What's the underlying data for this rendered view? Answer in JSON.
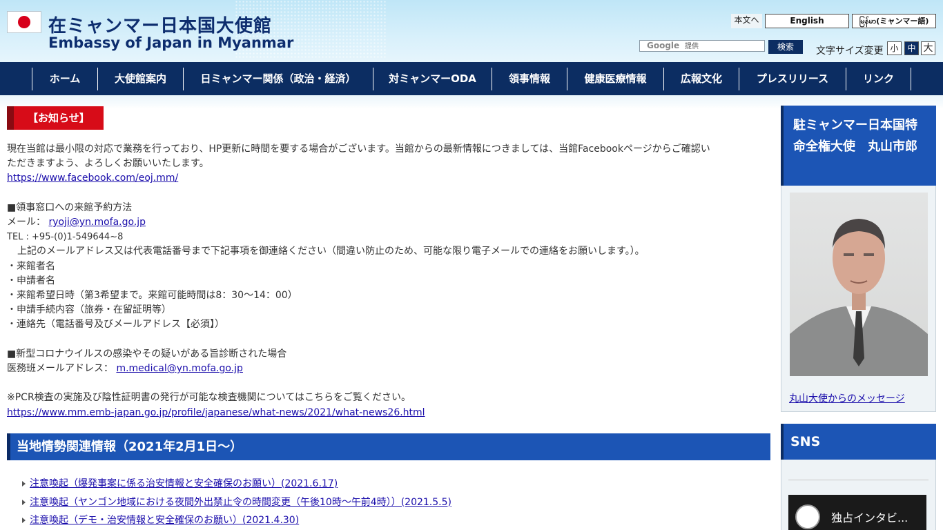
{
  "header": {
    "title_ja": "在ミャンマー日本国大使館",
    "title_en": "Embassy of Japan in Myanmar",
    "skip_label": "本文へ",
    "english_label": "English",
    "myanmar_label": "မြန်မာ(ミャンマー語)",
    "search_provider": "Google",
    "search_placeholder": "提供",
    "search_button": "検索",
    "fontsize_label": "文字サイズ変更",
    "fontsize_small": "小",
    "fontsize_medium": "中",
    "fontsize_large": "大"
  },
  "nav": {
    "items": [
      {
        "label": "ホーム"
      },
      {
        "label": "大使館案内"
      },
      {
        "label": "日ミャンマー関係（政治・経済）"
      },
      {
        "label": "対ミャンマーODA"
      },
      {
        "label": "領事情報"
      },
      {
        "label": "健康医療情報"
      },
      {
        "label": "広報文化"
      },
      {
        "label": "プレスリリース"
      },
      {
        "label": "リンク"
      }
    ]
  },
  "notice": {
    "title": "【お知らせ】",
    "para1_line1": "現在当館は最小限の対応で業務を行っており、HP更新に時間を要する場合がございます。当館からの最新情報につきましては、当館Facebookページからご確認い",
    "para1_line2": "ただきますよう、よろしくお願いいたします。",
    "facebook_link": "https://www.facebook.com/eoj.mm/",
    "reservation_heading": "■領事窓口への来館予約方法",
    "mail_label": "メール：",
    "mail_link": "ryoji@yn.mofa.go.jp",
    "tel": "TEL : +95-(0)1-549644~8",
    "instruction": "上記のメールアドレス又は代表電話番号まで下記事項を御連絡ください（間違い防止のため、可能な限り電子メールでの連絡をお願いします。）。",
    "items": [
      "・来館者名",
      "・申請者名",
      "・来館希望日時（第3希望まで。来館可能時間は8：30〜14：00）",
      "・申請手続内容（旅券・在留証明等）",
      "・連絡先（電話番号及びメールアドレス【必須】）"
    ],
    "covid_heading": "■新型コロナウイルスの感染やその疑いがある旨診断された場合",
    "medical_label": "医務班メールアドレス：",
    "medical_link": "m.medical@yn.mofa.go.jp",
    "pcr_note": "※PCR検査の実施及び陰性証明書の発行が可能な検査機関についてはこちらをご覧ください。",
    "pcr_link": "https://www.mm.emb-japan.go.jp/profile/japanese/what-news/2021/what-news26.html"
  },
  "situation": {
    "title": "当地情勢関連情報（2021年2月1日〜）",
    "links": [
      "注意喚起（爆発事案に係る治安情報と安全確保のお願い）(2021.6.17)",
      "注意喚起（ヤンゴン地域における夜間外出禁止令の時間変更（午後10時〜午前4時））(2021.5.5)",
      "注意喚起（デモ・治安情報と安全確保のお願い）(2021.4.30)"
    ]
  },
  "sidebar": {
    "ambassador_title": "駐ミャンマー日本国特命全権大使　丸山市郎",
    "ambassador_link": "丸山大使からのメッセージ",
    "sns_title": "SNS",
    "video_title": "独占インタビ..."
  },
  "colors": {
    "navy": "#0c2d62",
    "blue": "#1c55b5",
    "red": "#d70c18"
  }
}
